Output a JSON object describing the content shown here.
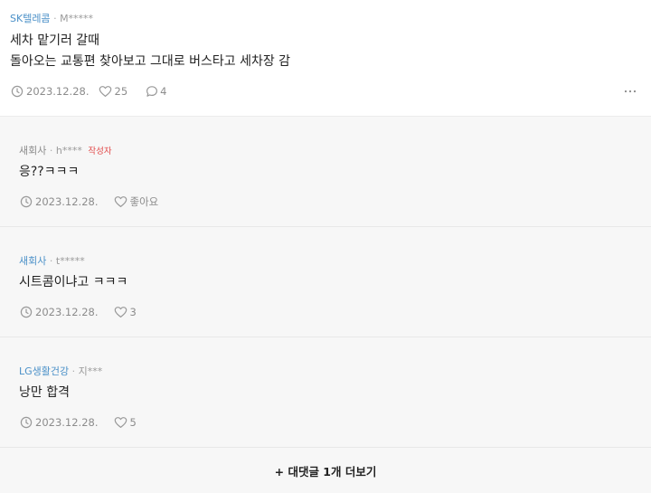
{
  "post": {
    "company": "SK텔레콤",
    "separator": "·",
    "author": "M*****",
    "line1": "세차 맡기러 갈때",
    "line2": "돌아오는 교통편 찾아보고 그대로 버스타고 세차장 감",
    "date": "2023.12.28.",
    "likes": "25",
    "comments": "4"
  },
  "comments": [
    {
      "company": "새회사",
      "separator": "·",
      "author": "h****",
      "author_tag": "작성자",
      "text": "응??ㅋㅋㅋ",
      "date": "2023.12.28.",
      "likes_label": "좋아요"
    },
    {
      "company": "새회사",
      "separator": "·",
      "author": "t*****",
      "text": "시트콤이냐고 ㅋㅋㅋ",
      "date": "2023.12.28.",
      "likes_label": "3"
    },
    {
      "company": "LG생활건강",
      "separator": "·",
      "author": "지***",
      "text": "낭만 합격",
      "date": "2023.12.28.",
      "likes_label": "5"
    }
  ],
  "more_replies_label": "+ 대댓글 1개 더보기",
  "icons": {
    "clock": "clock-icon",
    "heart": "heart-icon",
    "comment": "comment-icon",
    "more": "more-icon"
  }
}
